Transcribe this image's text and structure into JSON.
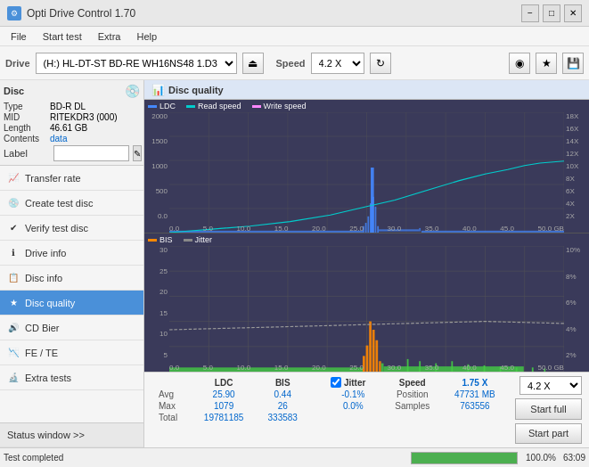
{
  "titlebar": {
    "title": "Opti Drive Control 1.70",
    "icon": "⚙",
    "minimize": "−",
    "maximize": "□",
    "close": "✕"
  },
  "menubar": {
    "items": [
      "File",
      "Start test",
      "Extra",
      "Help"
    ]
  },
  "toolbar": {
    "drive_label": "Drive",
    "drive_value": "(H:) HL-DT-ST BD-RE  WH16NS48 1.D3",
    "eject_icon": "⏏",
    "speed_label": "Speed",
    "speed_value": "4.2 X",
    "refresh_icon": "↻",
    "btn1_icon": "◉",
    "btn2_icon": "★",
    "btn3_icon": "💾"
  },
  "disc": {
    "section_label": "Disc",
    "icon": "💿",
    "type_label": "Type",
    "type_value": "BD-R DL",
    "mid_label": "MID",
    "mid_value": "RITEKDR3 (000)",
    "length_label": "Length",
    "length_value": "46.61 GB",
    "contents_label": "Contents",
    "contents_value": "data",
    "label_label": "Label",
    "label_placeholder": ""
  },
  "nav": {
    "items": [
      {
        "id": "transfer-rate",
        "label": "Transfer rate",
        "icon": "📈"
      },
      {
        "id": "create-test-disc",
        "label": "Create test disc",
        "icon": "💿"
      },
      {
        "id": "verify-test-disc",
        "label": "Verify test disc",
        "icon": "✔"
      },
      {
        "id": "drive-info",
        "label": "Drive info",
        "icon": "ℹ"
      },
      {
        "id": "disc-info",
        "label": "Disc info",
        "icon": "📋"
      },
      {
        "id": "disc-quality",
        "label": "Disc quality",
        "icon": "★",
        "active": true
      },
      {
        "id": "cd-bier",
        "label": "CD Bier",
        "icon": "🔊"
      },
      {
        "id": "fe-te",
        "label": "FE / TE",
        "icon": "📉"
      },
      {
        "id": "extra-tests",
        "label": "Extra tests",
        "icon": "🔬"
      }
    ],
    "status_btn": "Status window >>"
  },
  "chart": {
    "title": "Disc quality",
    "legend_upper": [
      {
        "label": "LDC",
        "color": "#4488ff"
      },
      {
        "label": "Read speed",
        "color": "#00cccc"
      },
      {
        "label": "Write speed",
        "color": "#ff88ff"
      }
    ],
    "legend_lower": [
      {
        "label": "BIS",
        "color": "#ff8800"
      },
      {
        "label": "Jitter",
        "color": "#888888"
      }
    ],
    "upper_y_left": [
      "2000",
      "1500",
      "1000",
      "500",
      "0.0"
    ],
    "upper_y_right": [
      "18X",
      "16X",
      "14X",
      "12X",
      "10X",
      "8X",
      "6X",
      "4X",
      "2X"
    ],
    "lower_y_left": [
      "30",
      "25",
      "20",
      "15",
      "10",
      "5"
    ],
    "lower_y_right": [
      "10%",
      "8%",
      "6%",
      "4%",
      "2%"
    ],
    "x_labels": [
      "0.0",
      "5.0",
      "10.0",
      "15.0",
      "20.0",
      "25.0",
      "30.0",
      "35.0",
      "40.0",
      "45.0",
      "50.0 GB"
    ]
  },
  "stats": {
    "headers": [
      "LDC",
      "BIS",
      "",
      "Jitter",
      "Speed",
      "1.75 X"
    ],
    "avg_label": "Avg",
    "avg_ldc": "25.90",
    "avg_bis": "0.44",
    "avg_jitter": "-0.1%",
    "max_label": "Max",
    "max_ldc": "1079",
    "max_bis": "26",
    "max_jitter": "0.0%",
    "position_label": "Position",
    "position_value": "47731 MB",
    "total_label": "Total",
    "total_ldc": "19781185",
    "total_bis": "333583",
    "samples_label": "Samples",
    "samples_value": "763556",
    "jitter_checked": true,
    "speed_select": "4.2 X",
    "start_full_label": "Start full",
    "start_part_label": "Start part"
  },
  "statusbar": {
    "text": "Test completed",
    "progress": 100,
    "progress_label": "100.0%",
    "time": "63:09"
  }
}
